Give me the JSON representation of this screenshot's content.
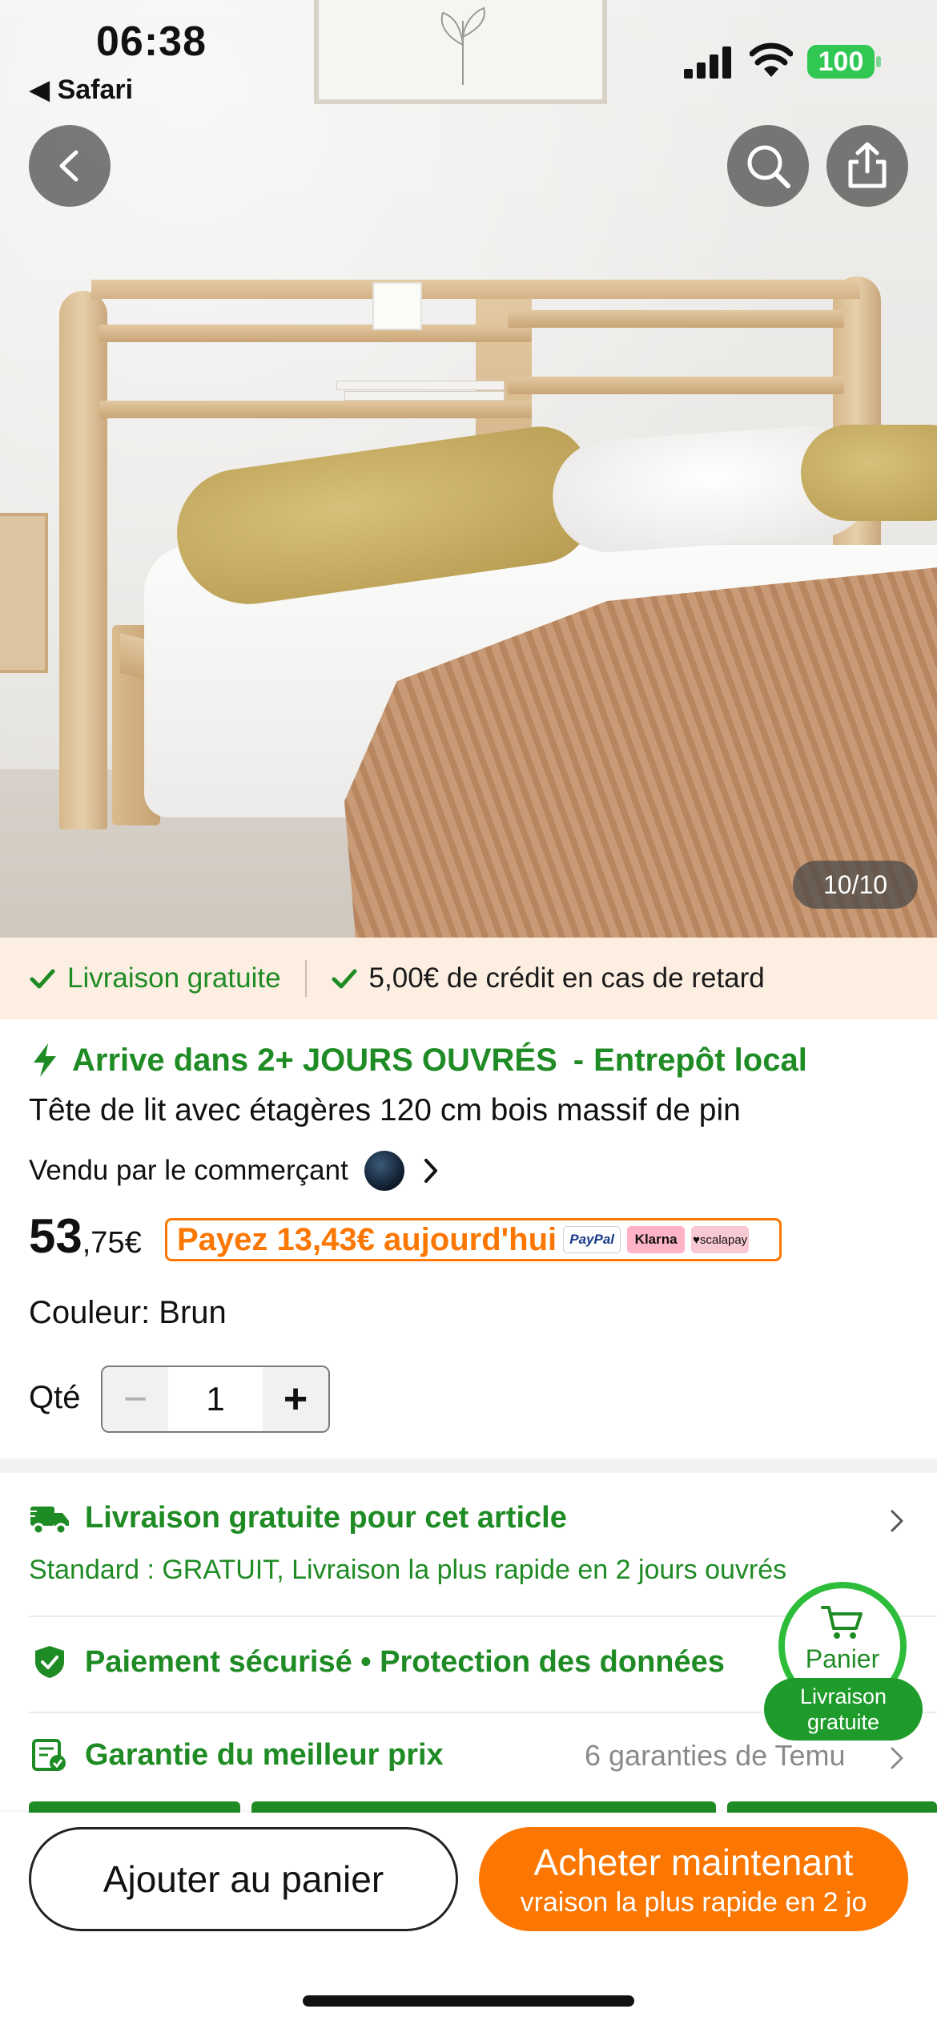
{
  "status_bar": {
    "time": "06:38",
    "back_app": "◀ Safari",
    "battery": "100"
  },
  "hero": {
    "image_counter": "10/10",
    "icons": [
      "back-icon",
      "search-icon",
      "share-icon"
    ]
  },
  "benefits": {
    "free_shipping": "Livraison gratuite",
    "late_credit": "5,00€ de crédit en cas de retard"
  },
  "product": {
    "arrival": "Arrive dans 2+ JOURS OUVRÉS",
    "arrival_sep": "-",
    "warehouse": "Entrepôt local",
    "title": "Tête de lit avec étagères 120 cm bois massif de pin",
    "vendor": "Vendu par le commerçant",
    "price_int": "53",
    "price_dec": ",75€",
    "pay_today": "Payez 13,43€ aujourd'hui",
    "pay_logos": [
      "PayPal",
      "Klarna",
      "♥scalapay"
    ],
    "color": "Couleur: Brun",
    "qty_label": "Qté",
    "qty_minus": "−",
    "qty_value": "1",
    "qty_plus": "+"
  },
  "services": {
    "shipping_title": "Livraison gratuite pour cet article",
    "shipping_sub": "Standard : GRATUIT, Livraison la plus rapide en 2 jours ouvrés",
    "security": "Paiement sécurisé • Protection des données",
    "best_price": "Garantie du meilleur prix",
    "guarantees": "6 garanties de Temu"
  },
  "cart_bubble": {
    "label": "Panier",
    "badge": "Livraison gratuite"
  },
  "actions": {
    "add_to_cart": "Ajouter au panier",
    "buy_now": "Acheter maintenant",
    "buy_now_sub": "vraison la plus rapide en 2 jo"
  },
  "colors": {
    "accent_orange": "#fb7701",
    "accent_green": "#1f8b24",
    "benefit_bg": "#fdeee2"
  }
}
